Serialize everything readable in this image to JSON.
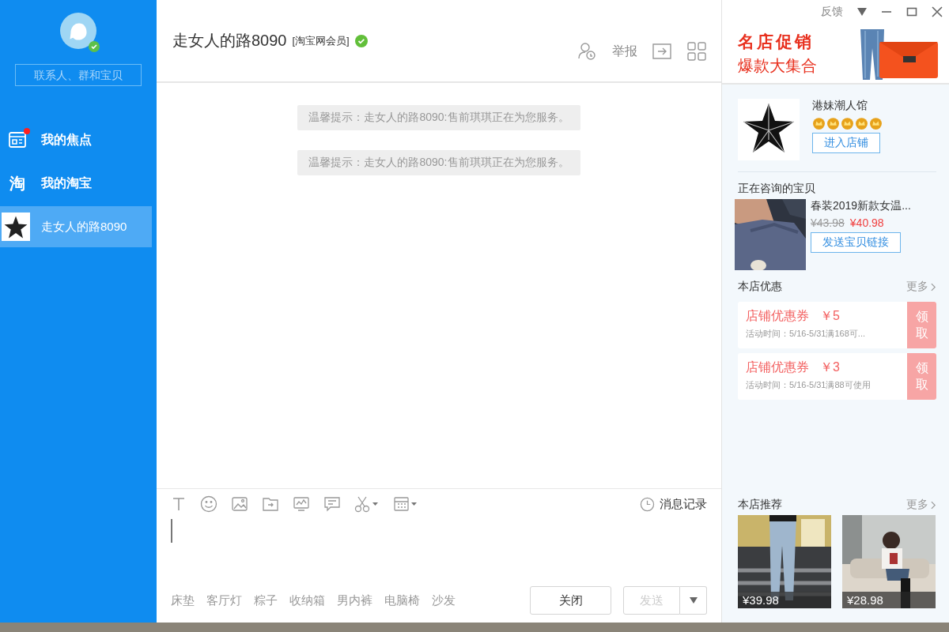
{
  "sidebar": {
    "search": {
      "placeholder": "联系人、群和宝贝"
    },
    "online": true,
    "items": [
      {
        "kind": "focus",
        "label": "我的焦点",
        "badge": true,
        "selected": false
      },
      {
        "kind": "taobao",
        "icon_text": "淘",
        "label": "我的淘宝",
        "badge": false,
        "selected": false
      },
      {
        "kind": "contact",
        "label": "走女人的路8090",
        "badge": false,
        "selected": true
      }
    ]
  },
  "titlebar": {
    "feedback": "反馈"
  },
  "header": {
    "title": "走女人的路8090",
    "member": "[淘宝网会员]",
    "verified": true,
    "report": "举报"
  },
  "ad": {
    "line_1": "名店促销",
    "line_2": "爆款大集合",
    "kind": "picture"
  },
  "messages": [
    {
      "text": "温馨提示：走女人的路8090:售前琪琪正在为您服务。"
    },
    {
      "text": "温馨提示：走女人的路8090:售前琪琪正在为您服务。"
    }
  ],
  "composer": {
    "history": "消息记录",
    "quick_words": [
      "床垫",
      "客厅灯",
      "粽子",
      "收纳箱",
      "男内裤",
      "电脑椅",
      "沙发"
    ],
    "buttons": [
      {
        "kind": "close",
        "label": "关闭",
        "disabled": false
      },
      {
        "kind": "send",
        "label": "发送",
        "disabled": true
      }
    ]
  },
  "shop": {
    "name": "港妹潮人馆",
    "stars": 5,
    "enter": "进入店铺"
  },
  "consulting": {
    "heading": "正在咨询的宝贝",
    "title": "春装2019新款女温...",
    "old_price": "¥43.98",
    "price": "¥40.98",
    "send_link": "发送宝贝链接"
  },
  "coupons": {
    "heading": "本店优惠",
    "more": "更多",
    "items": [
      {
        "title": "店铺优惠券",
        "amount": "￥5",
        "desc": "活动时间：5/16-5/31满168可...",
        "claim": "领取"
      },
      {
        "title": "店铺优惠券",
        "amount": "￥3",
        "desc": "活动时间：5/16-5/31满88可使用",
        "claim": "领取"
      }
    ]
  },
  "recommend": {
    "heading": "本店推荐",
    "more": "更多",
    "items": [
      {
        "kind": "street",
        "price": "¥39.98"
      },
      {
        "kind": "sofa",
        "price": "¥28.98"
      }
    ]
  }
}
